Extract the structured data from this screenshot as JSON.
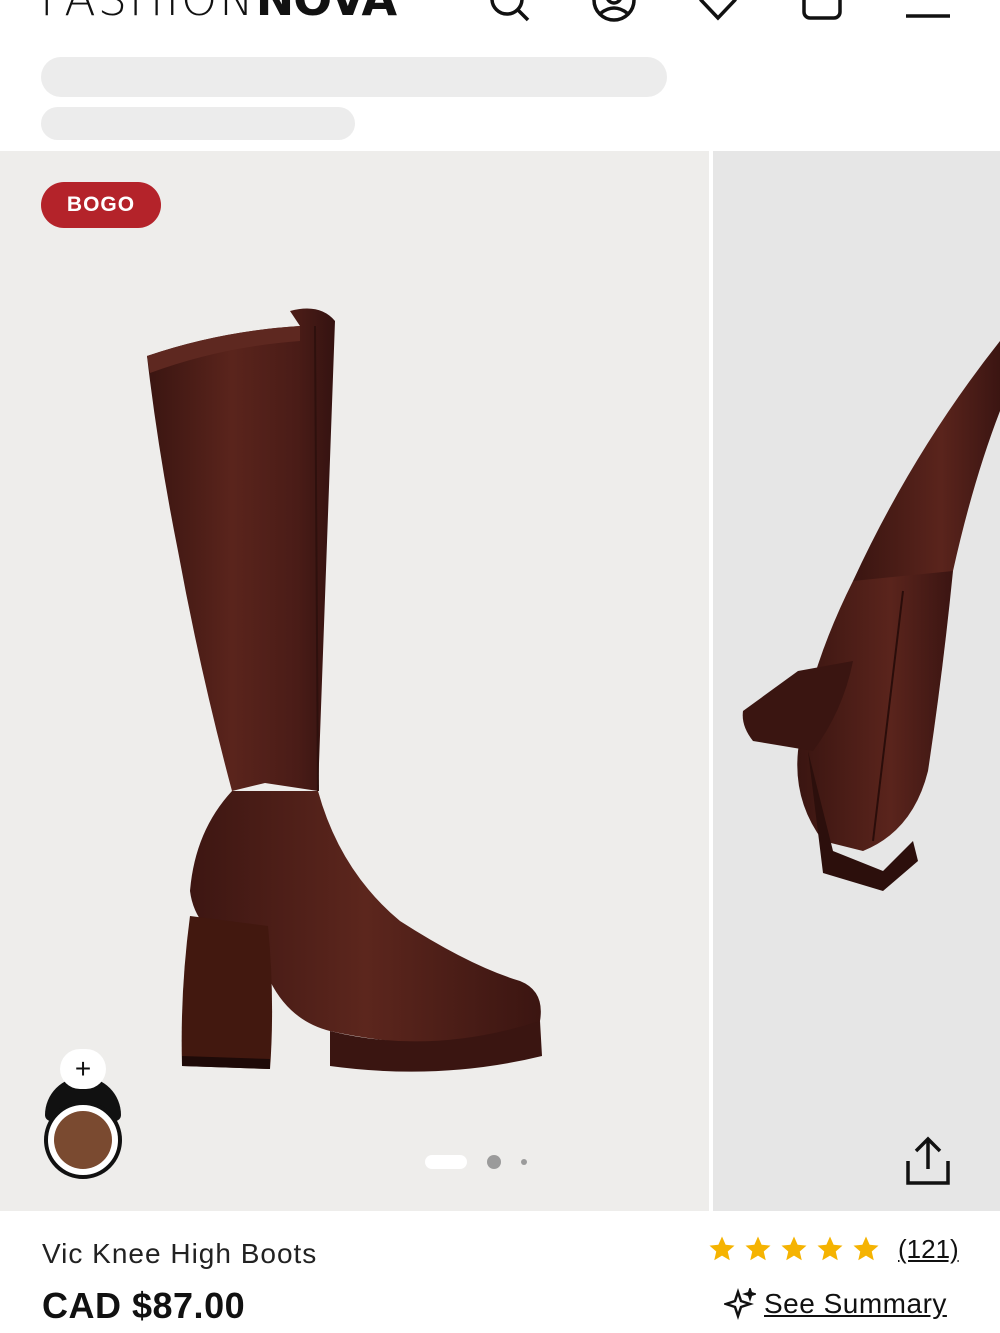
{
  "header": {
    "logo_light": "FASHION",
    "logo_bold": "NOVA",
    "icons": [
      "search-icon",
      "account-icon",
      "wishlist-heart-icon",
      "bag-icon",
      "menu-icon"
    ]
  },
  "gallery": {
    "badge": "BOGO",
    "swatch_plus": "+",
    "swatch_color": "#7a4a30",
    "slide_count": 3,
    "active_slide": 1
  },
  "product": {
    "title": "Vic Knee High Boots",
    "price": "CAD $87.00",
    "rating": 5,
    "reviews": "(121)",
    "summary_label": "See Summary"
  },
  "colors": {
    "badge_bg": "#b4232a",
    "boot_brown": "#4a1c17",
    "star": "#f5b301"
  }
}
